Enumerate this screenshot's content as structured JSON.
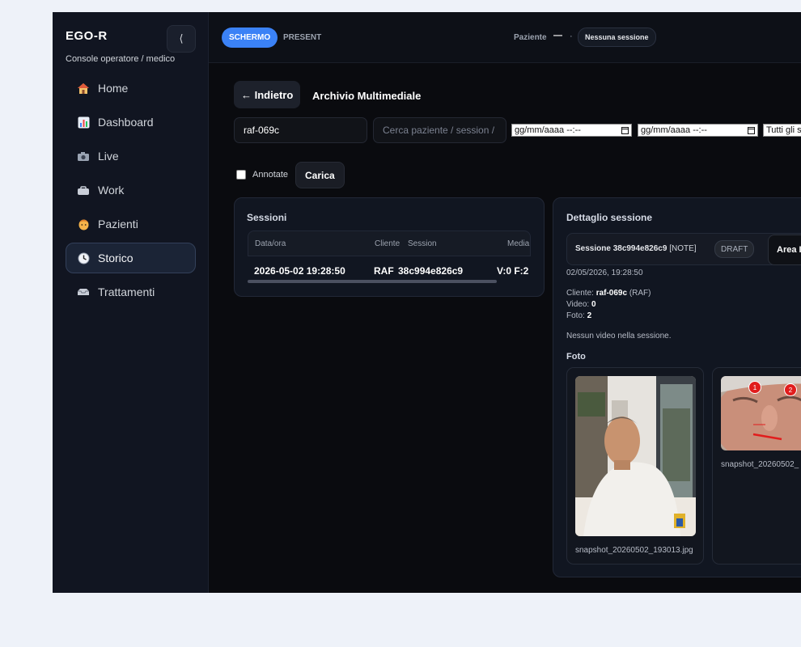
{
  "sidebar": {
    "brand": "EGO-R",
    "subtitle": "Console operatore / medico",
    "collapse": "⟨",
    "items": [
      {
        "label": "Home",
        "icon": "house-icon"
      },
      {
        "label": "Dashboard",
        "icon": "bar-chart-icon"
      },
      {
        "label": "Live",
        "icon": "camera-icon"
      },
      {
        "label": "Work",
        "icon": "briefcase-icon"
      },
      {
        "label": "Pazienti",
        "icon": "face-icon"
      },
      {
        "label": "Storico",
        "icon": "clock-icon",
        "active": true
      },
      {
        "label": "Trattamenti",
        "icon": "tray-icon"
      }
    ]
  },
  "topbar": {
    "screen_btn": "SCHERMO",
    "present_btn": "PRESENT",
    "patient_label": "Paziente",
    "patient_value": "—",
    "patient_sep": "·",
    "session_status": "Nessuna sessione"
  },
  "archive": {
    "back_label": "← Indietro",
    "title": "Archivio Multimediale",
    "client_value": "raf-069c",
    "search_placeholder": "Cerca paziente / session / n",
    "date_from": "gg/mm/aaaa --:--",
    "date_to": "gg/mm/aaaa --:--",
    "filter_select": "Tutti gli s",
    "annotated_label": "Annotate",
    "load_label": "Carica"
  },
  "sessions": {
    "title": "Sessioni",
    "columns": [
      "Data/ora",
      "Cliente",
      "Session",
      "Media"
    ],
    "rows": [
      {
        "datetime": "2026-05-02 19:28:50",
        "client": "RAF",
        "session": "38c994e826c9",
        "media": "V:0 F:2"
      }
    ]
  },
  "detail": {
    "title": "Dettaglio sessione",
    "session_prefix": "Sessione 38c994e826c9",
    "session_tag": "[NOTE]",
    "draft": "DRAFT",
    "area_btn": "Area I",
    "date": "02/05/2026, 19:28:50",
    "client_label": "Cliente:",
    "client_value": "raf-069c",
    "client_suffix": "(RAF)",
    "video_label": "Video:",
    "video_value": "0",
    "photo_label": "Foto:",
    "photo_value": "2",
    "no_video": "Nessun video nella sessione.",
    "photos_heading": "Foto",
    "photos": [
      {
        "caption": "snapshot_20260502_193013.jpg"
      },
      {
        "caption": "snapshot_20260502_",
        "pins": [
          "1",
          "2"
        ]
      }
    ]
  },
  "colors": {
    "accent": "#3b82f6",
    "marker": "#e11d1d"
  }
}
